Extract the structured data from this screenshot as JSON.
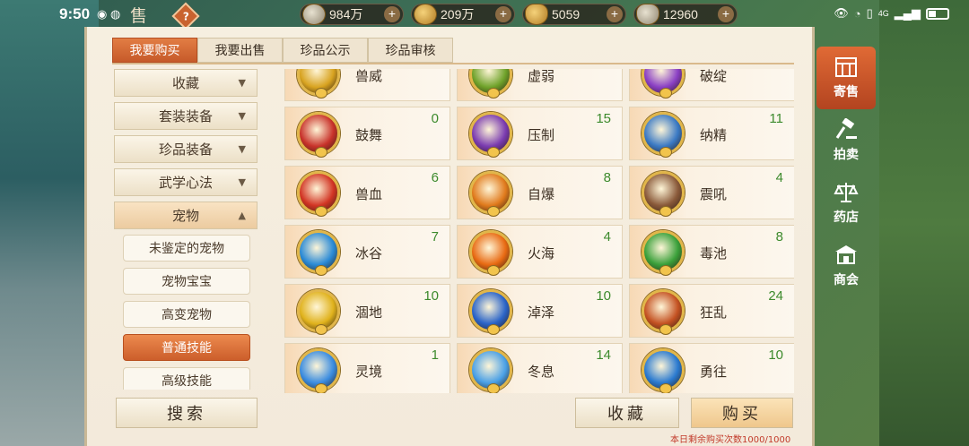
{
  "status_bar": {
    "time": "9:50",
    "network": "4G"
  },
  "header": {
    "title": "售",
    "help": "?"
  },
  "currencies": [
    {
      "icon": "coin-silver-icon",
      "value": "984万"
    },
    {
      "icon": "coin-gold-icon",
      "value": "209万"
    },
    {
      "icon": "ingot-gold-icon",
      "value": "5059"
    },
    {
      "icon": "ingot-silver-icon",
      "value": "12960"
    }
  ],
  "tabs": [
    "我要购买",
    "我要出售",
    "珍品公示",
    "珍品审核"
  ],
  "sidebar": {
    "categories": [
      "收藏",
      "套装装备",
      "珍品装备",
      "武学心法"
    ],
    "open_category": "宠物",
    "subcategories": [
      "未鉴定的宠物",
      "宠物宝宝",
      "高变宠物",
      "普通技能",
      "高级技能"
    ]
  },
  "skills": [
    {
      "name": "兽威",
      "count": "",
      "color": "#d8a320"
    },
    {
      "name": "虚弱",
      "count": "",
      "color": "#6fa22a"
    },
    {
      "name": "破绽",
      "count": "",
      "color": "#8a3fc4"
    },
    {
      "name": "鼓舞",
      "count": "0",
      "color": "#c8322a"
    },
    {
      "name": "压制",
      "count": "15",
      "color": "#7a3bb0"
    },
    {
      "name": "纳精",
      "count": "11",
      "color": "#3a79c4"
    },
    {
      "name": "兽血",
      "count": "6",
      "color": "#d23524"
    },
    {
      "name": "自爆",
      "count": "8",
      "color": "#e07a1c"
    },
    {
      "name": "震吼",
      "count": "4",
      "color": "#8a5a3a"
    },
    {
      "name": "冰谷",
      "count": "7",
      "color": "#2a8ad6"
    },
    {
      "name": "火海",
      "count": "4",
      "color": "#e86a12"
    },
    {
      "name": "毒池",
      "count": "8",
      "color": "#3aa03a"
    },
    {
      "name": "涸地",
      "count": "10",
      "color": "#e0b21c"
    },
    {
      "name": "淖泽",
      "count": "10",
      "color": "#2a64c8"
    },
    {
      "name": "狂乱",
      "count": "24",
      "color": "#c45222"
    },
    {
      "name": "灵境",
      "count": "1",
      "color": "#3a8ce0"
    },
    {
      "name": "冬息",
      "count": "14",
      "color": "#4aa0e6"
    },
    {
      "name": "勇往",
      "count": "10",
      "color": "#2a7ad0"
    }
  ],
  "buttons": {
    "search": "搜索",
    "favorite": "收藏",
    "buy": "购买"
  },
  "quota_text": "本日剩余购买次数1000/1000",
  "right_nav": [
    "寄售",
    "拍卖",
    "药店",
    "商会"
  ]
}
